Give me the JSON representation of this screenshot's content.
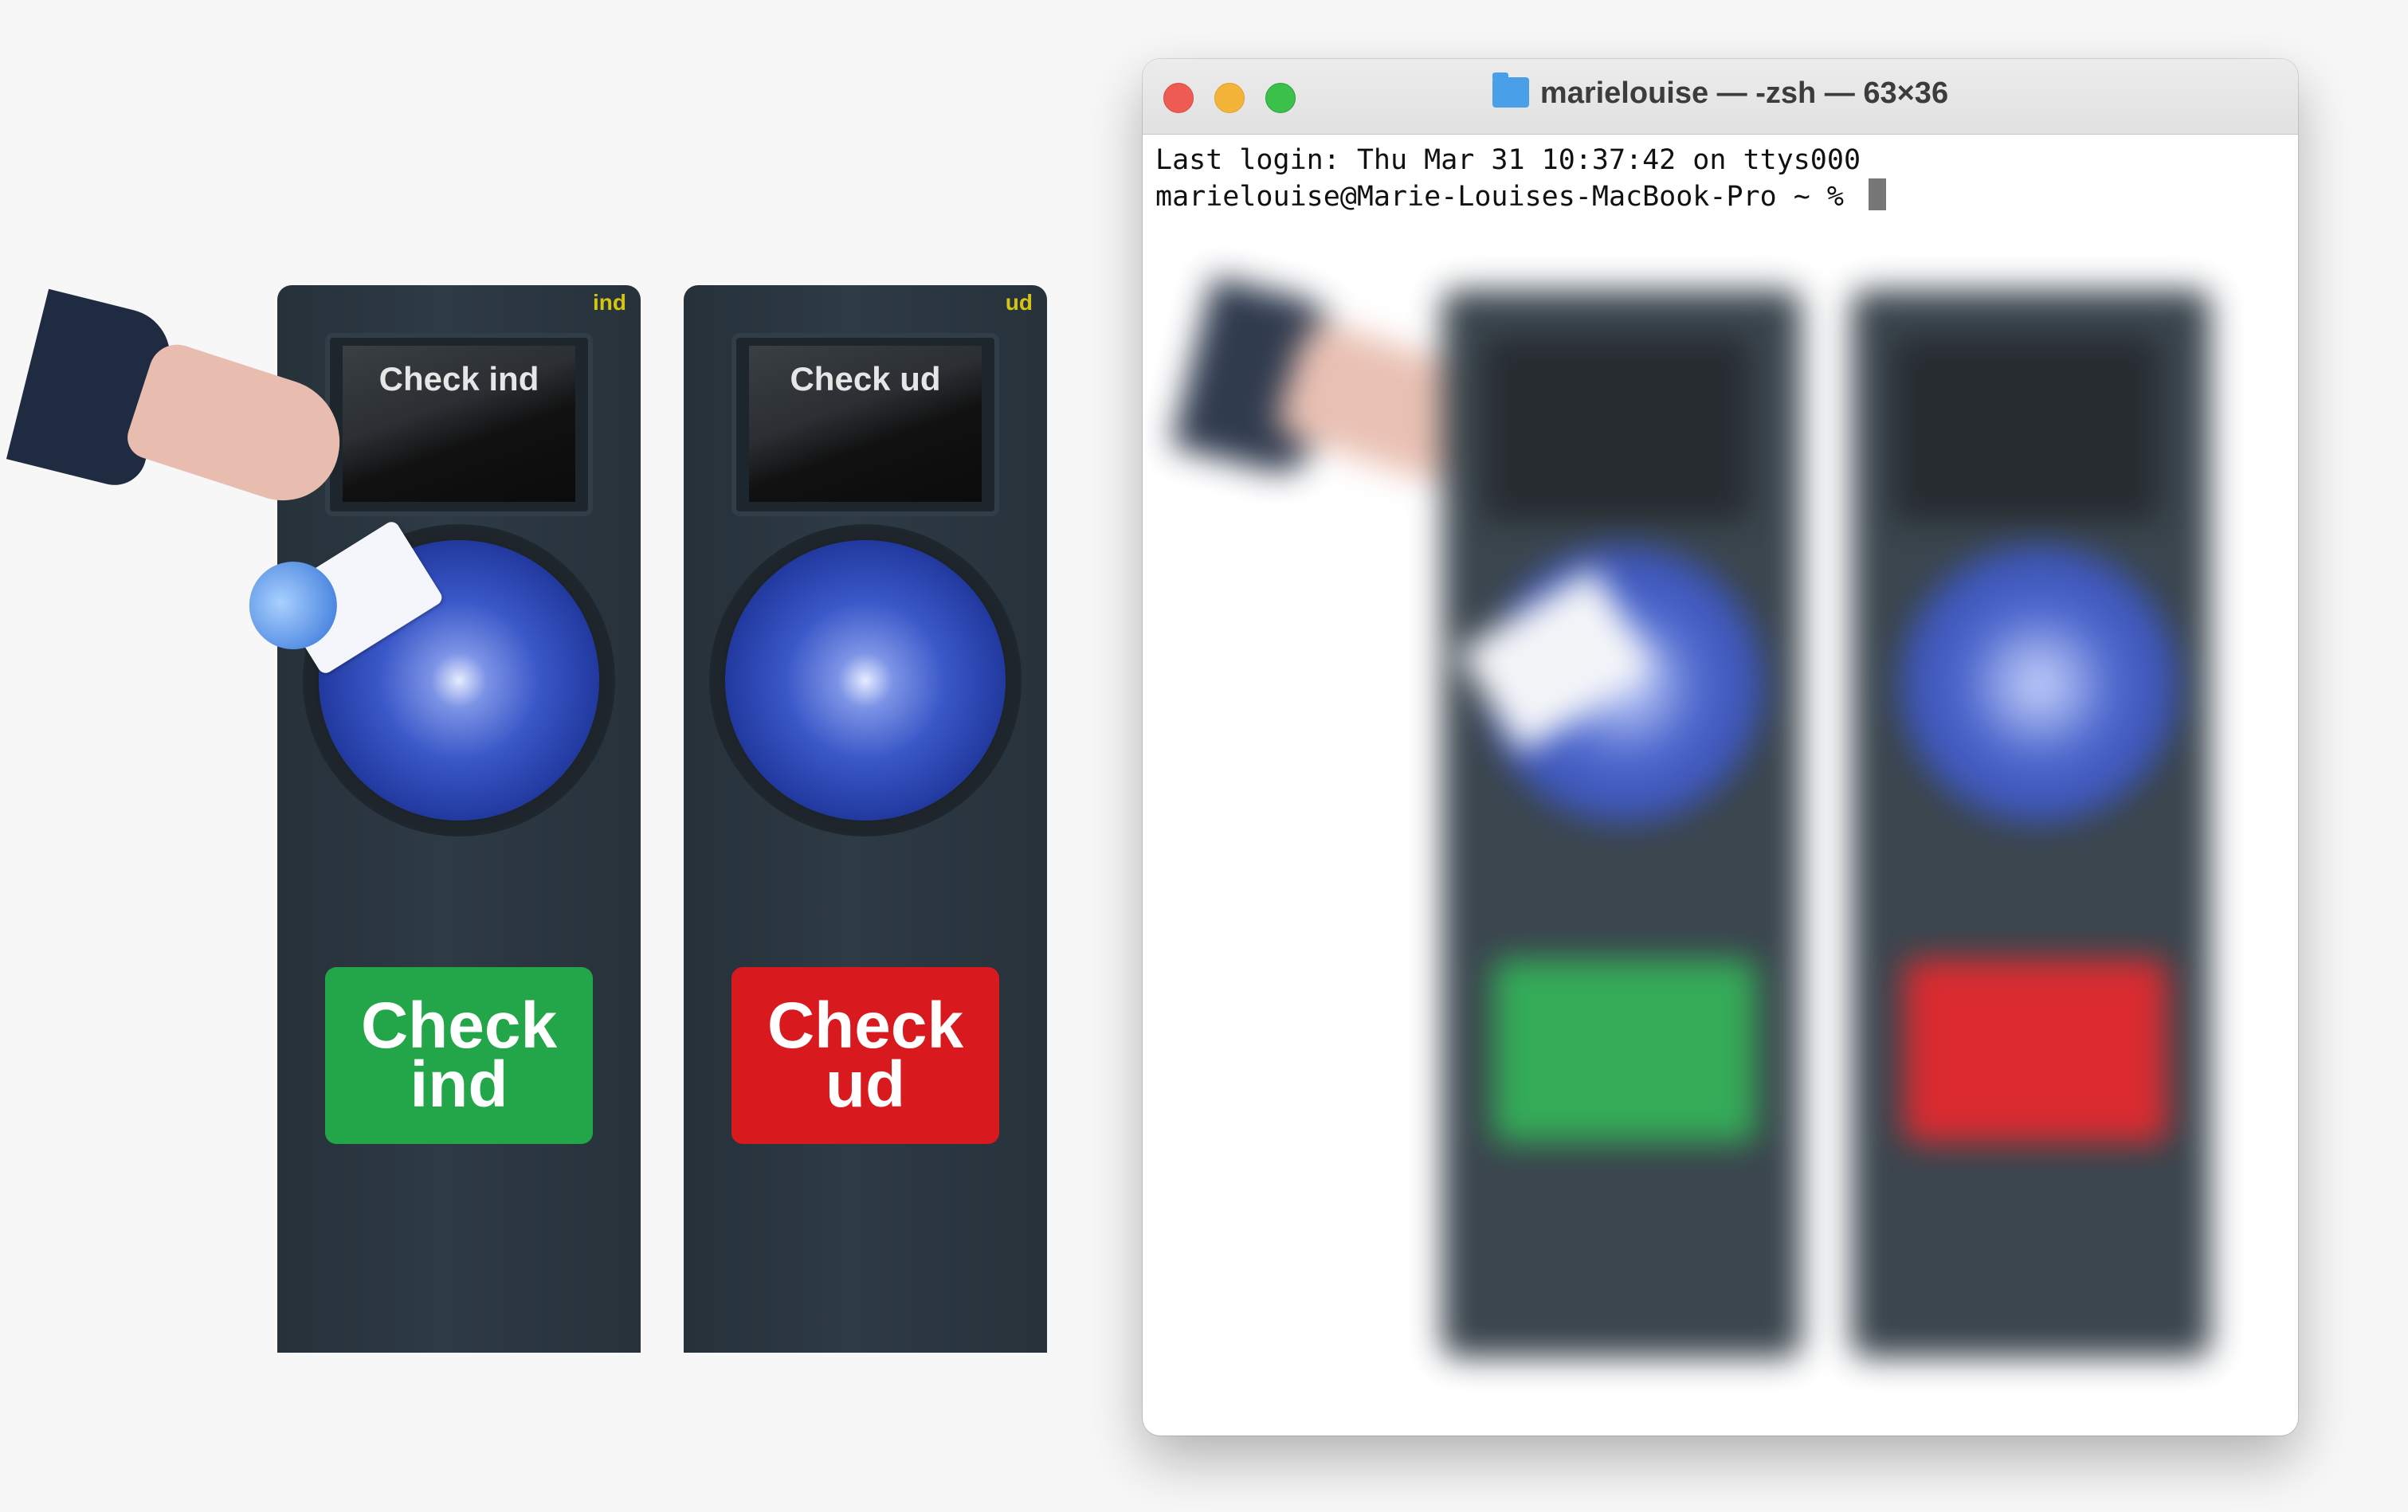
{
  "illustration": {
    "machines": [
      {
        "tag": "ind",
        "screen_label": "Check ind",
        "button_line1": "Check",
        "button_line2": "ind",
        "button_color": "#23a54a"
      },
      {
        "tag": "ud",
        "screen_label": "Check ud",
        "button_line1": "Check",
        "button_line2": "ud",
        "button_color": "#d81a1f"
      }
    ]
  },
  "terminal": {
    "title": "marielouise — -zsh — 63×36",
    "lines": [
      "Last login: Thu Mar 31 10:37:42 on ttys000",
      "marielouise@Marie-Louises-MacBook-Pro ~ % "
    ]
  },
  "colors": {
    "reader_blue": "#3a58c8",
    "accent_yellow": "#d4c414"
  }
}
